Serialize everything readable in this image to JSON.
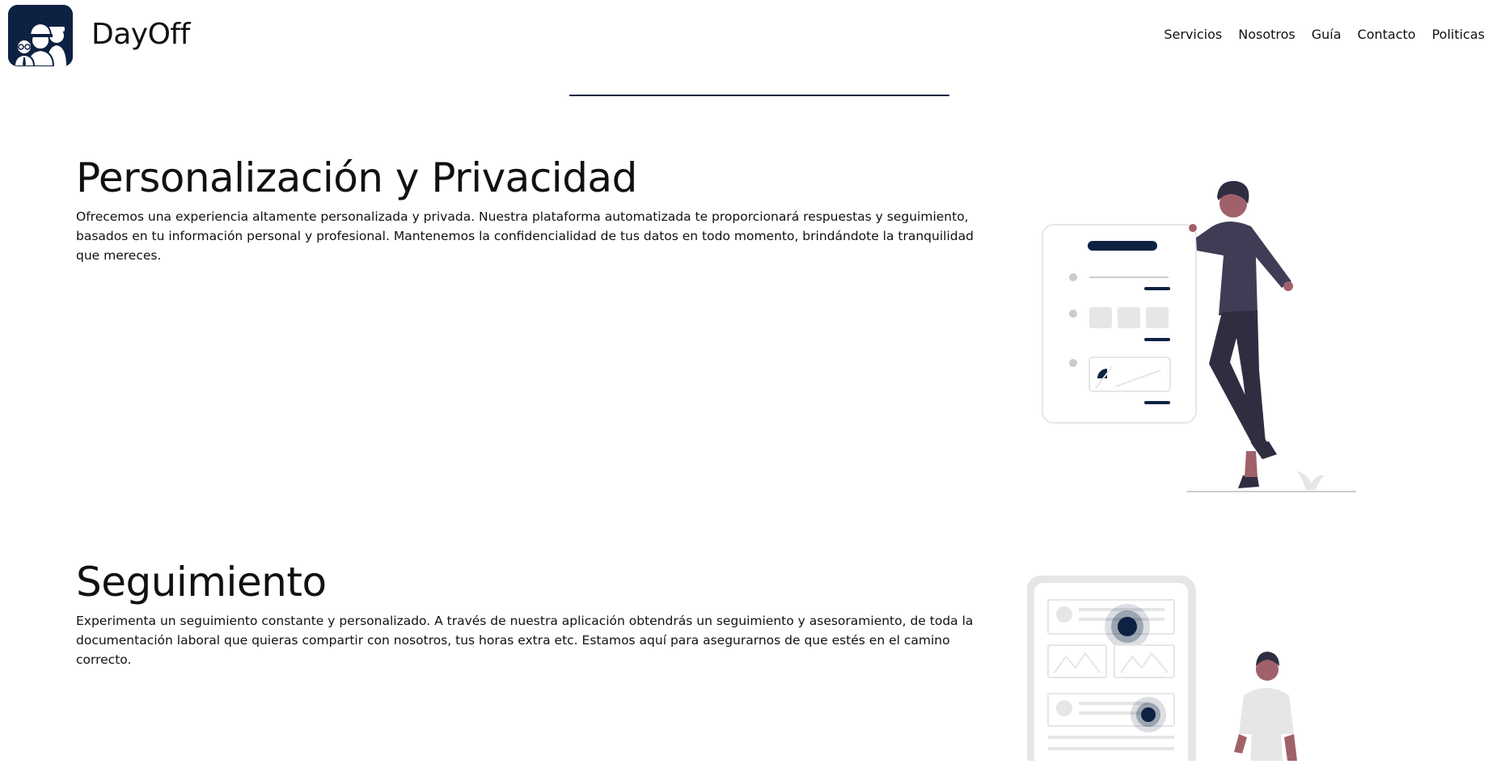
{
  "header": {
    "brand": "DayOff",
    "nav": [
      "Servicios",
      "Nosotros",
      "Guía",
      "Contacto",
      "Politicas"
    ]
  },
  "sections": [
    {
      "title": "Personalización y Privacidad",
      "body": "Ofrecemos una experiencia altamente personalizada y privada. Nuestra plataforma automatizada te proporcionará respuestas y seguimiento, basados en tu información personal y profesional. Mantenemos la confidencialidad de tus datos en todo momento, brindándote la tranquilidad que mereces."
    },
    {
      "title": "Seguimiento",
      "body": "Experimenta un seguimiento constante y personalizado. A través de nuestra aplicación obtendrás un seguimiento y asesoramiento, de toda la documentación laboral que quieras compartir con nosotros, tus horas extra etc. Estamos aquí para asegurarnos de que estés en el camino correcto."
    }
  ],
  "colors": {
    "navy": "#0d2142",
    "person_dark": "#3f3d56",
    "skin": "#a0616a",
    "light_gray": "#e6e6e6"
  },
  "icons": {
    "logo": "workers-logo-icon"
  }
}
